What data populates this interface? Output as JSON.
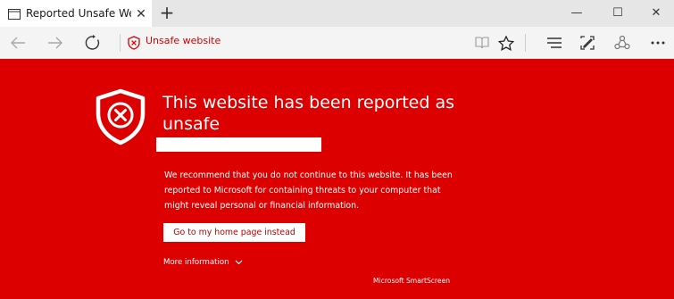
{
  "tab": {
    "title": "Reported Unsafe Websit",
    "close": "✕",
    "new_tab": "+"
  },
  "window_controls": {
    "minimize": "—",
    "maximize": "☐",
    "close": "✕"
  },
  "address_bar": {
    "label": "Unsafe website"
  },
  "icons": [
    "back-icon",
    "forward-icon",
    "refresh-icon",
    "warning-shield-icon",
    "reading-view-icon",
    "favorite-star-icon",
    "hub-icon",
    "web-note-icon",
    "share-icon",
    "more-icon"
  ],
  "page": {
    "headline": "This website has been reported as unsafe",
    "body": "We recommend that you do not continue to this website. It has been reported to Microsoft for containing threats to your computer that might reveal personal or financial information.",
    "home_button": "Go to my home page instead",
    "more_info": "More information",
    "footer": "Microsoft SmartScreen"
  },
  "colors": {
    "background": "#dc0000",
    "text": "#ffffff",
    "button_text": "#c00000",
    "tab_bar": "#e6e6e6",
    "address_bar": "#f4f4f4"
  }
}
